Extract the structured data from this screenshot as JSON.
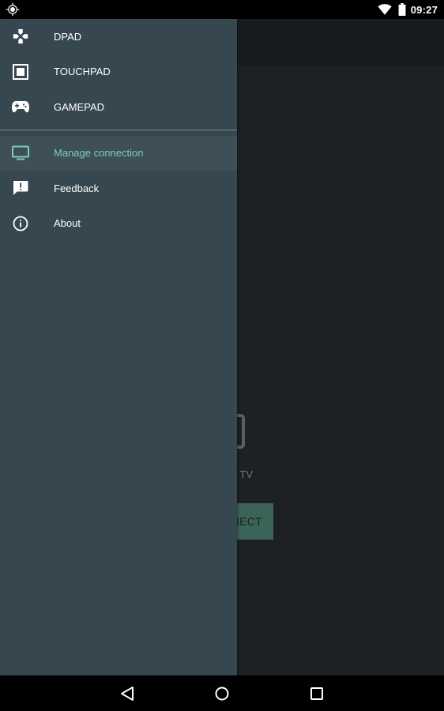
{
  "status_bar": {
    "time": "09:27",
    "icons": [
      "location-icon",
      "wifi-icon",
      "battery-icon"
    ]
  },
  "drawer": {
    "modes": [
      {
        "label": "DPAD",
        "icon": "dpad-icon"
      },
      {
        "label": "TOUCHPAD",
        "icon": "touchpad-icon"
      },
      {
        "label": "GAMEPAD",
        "icon": "gamepad-icon"
      }
    ],
    "actions": [
      {
        "label": "Manage connection",
        "icon": "tv-icon",
        "active": true
      },
      {
        "label": "Feedback",
        "icon": "feedback-icon"
      },
      {
        "label": "About",
        "icon": "info-icon"
      }
    ]
  },
  "main": {
    "status_text": "TV",
    "connect_button": "NECT"
  },
  "nav_bar": {
    "buttons": [
      "back-icon",
      "home-icon",
      "recents-icon"
    ]
  },
  "colors": {
    "drawer_bg": "#37474f",
    "active_item_bg": "#3f4f57",
    "accent": "#7fcac0",
    "background": "#1d2124",
    "connect_button_bg": "#3b6357"
  }
}
